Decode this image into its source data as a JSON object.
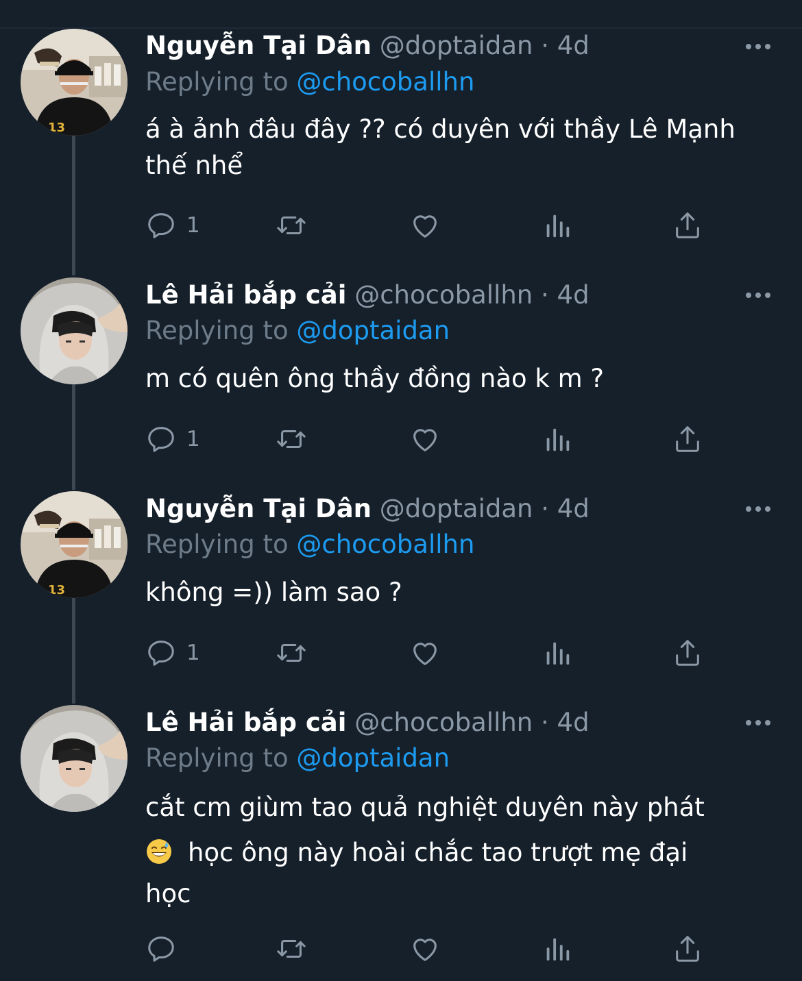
{
  "tweets": [
    {
      "name": "Nguyễn Tại Dân",
      "handle": "@doptaidan",
      "sep": "·",
      "time": "4d",
      "replying_prefix": "Replying to",
      "replying_to": "@chocoballhn",
      "text_lines": [
        "á à ảnh đâu đây ?? có duyên với thầy Lê Mạnh",
        "thế nhể"
      ],
      "reply_count": "1",
      "avatar": "man-cap-avatar"
    },
    {
      "name": "Lê Hải bắp cải",
      "handle": "@chocoballhn",
      "sep": "·",
      "time": "4d",
      "replying_prefix": "Replying to",
      "replying_to": "@doptaidan",
      "text_lines": [
        "m có quên ông thầy đồng nào k m ?"
      ],
      "reply_count": "1",
      "avatar": "hoodie-avatar"
    },
    {
      "name": "Nguyễn Tại Dân",
      "handle": "@doptaidan",
      "sep": "·",
      "time": "4d",
      "replying_prefix": "Replying to",
      "replying_to": "@chocoballhn",
      "text_lines": [
        "không =)) làm sao ?"
      ],
      "reply_count": "1",
      "avatar": "man-cap-avatar"
    },
    {
      "name": "Lê Hải bắp cải",
      "handle": "@chocoballhn",
      "sep": "·",
      "time": "4d",
      "replying_prefix": "Replying to",
      "replying_to": "@doptaidan",
      "text_lines": [
        "cắt cm giùm tao quả nghiệt duyên này phát",
        "học ông này hoài chắc tao trượt mẹ đại",
        "học"
      ],
      "emoji_line": 1,
      "emoji": "grinning-sweat-emoji",
      "reply_count": "",
      "avatar": "hoodie-avatar"
    }
  ],
  "icons": {
    "reply": "reply-icon",
    "retweet": "retweet-icon",
    "like": "like-icon",
    "analytics": "analytics-icon",
    "share": "share-icon",
    "more": "more-icon"
  },
  "colors": {
    "background": "#15202b",
    "link": "#1d9bf0",
    "secondary": "#8b98a5",
    "thread_line": "#3d4852"
  }
}
